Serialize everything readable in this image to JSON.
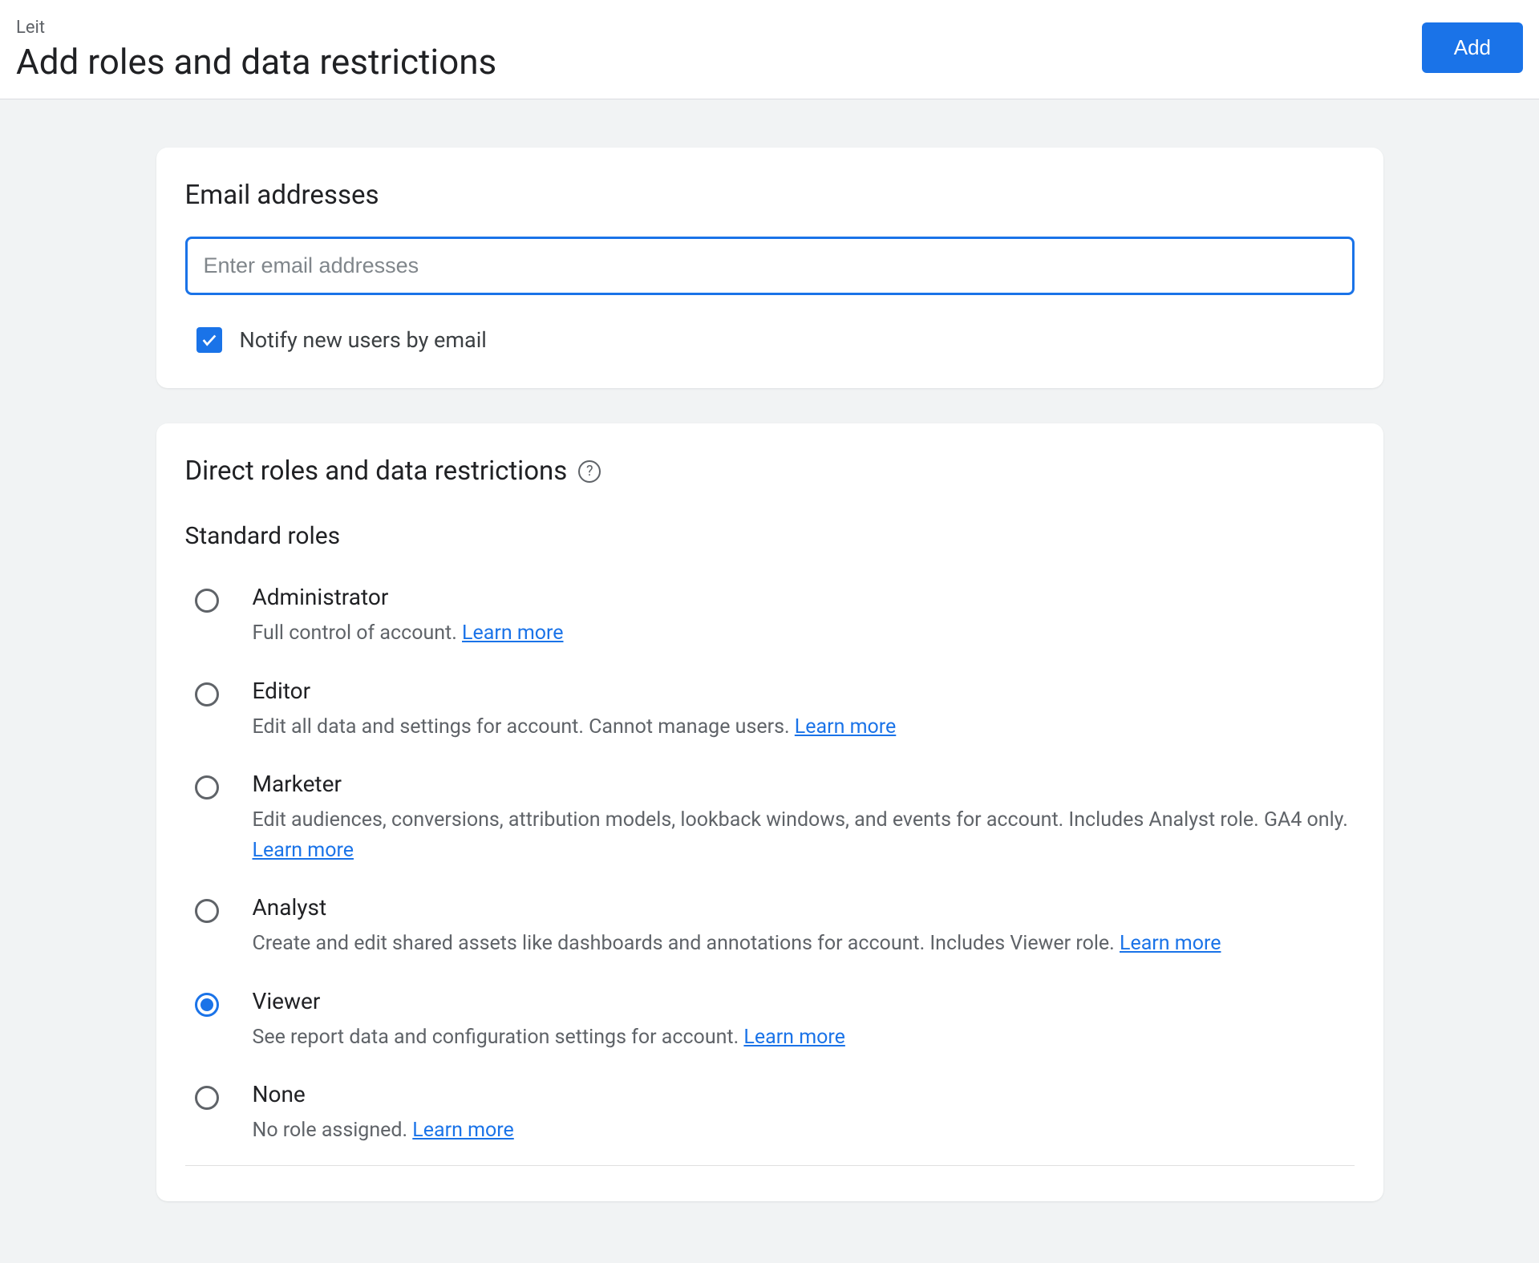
{
  "header": {
    "breadcrumb": "Leit",
    "title": "Add roles and data restrictions",
    "add_button": "Add"
  },
  "email_section": {
    "title": "Email addresses",
    "placeholder": "Enter email addresses",
    "notify_label": "Notify new users by email",
    "notify_checked": true
  },
  "roles_section": {
    "title": "Direct roles and data restrictions",
    "subtitle": "Standard roles",
    "learn_more": "Learn more",
    "roles": [
      {
        "id": "administrator",
        "title": "Administrator",
        "description": "Full control of account. ",
        "selected": false
      },
      {
        "id": "editor",
        "title": "Editor",
        "description": "Edit all data and settings for account. Cannot manage users. ",
        "selected": false
      },
      {
        "id": "marketer",
        "title": "Marketer",
        "description": "Edit audiences, conversions, attribution models, lookback windows, and events for account. Includes Analyst role. GA4 only. ",
        "selected": false
      },
      {
        "id": "analyst",
        "title": "Analyst",
        "description": "Create and edit shared assets like dashboards and annotations for account. Includes Viewer role. ",
        "selected": false
      },
      {
        "id": "viewer",
        "title": "Viewer",
        "description": "See report data and configuration settings for account. ",
        "selected": true
      },
      {
        "id": "none",
        "title": "None",
        "description": "No role assigned. ",
        "selected": false
      }
    ]
  }
}
